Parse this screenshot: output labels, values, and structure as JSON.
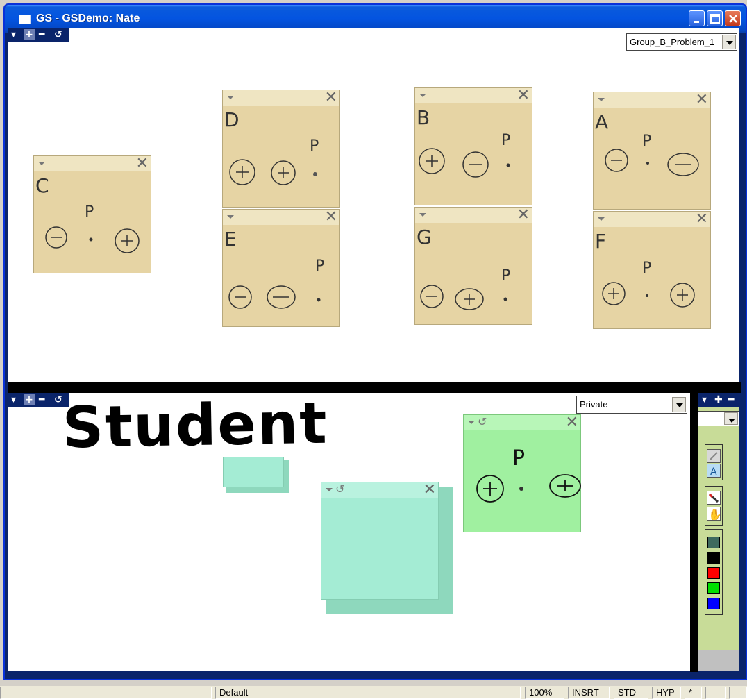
{
  "window": {
    "title": "GS - GSDemo: Nate",
    "titlebar_color": "#0454e0"
  },
  "top_pane": {
    "problem_select": "Group_B_Problem_1",
    "notes": [
      {
        "letter": "C"
      },
      {
        "letter": "D"
      },
      {
        "letter": "B"
      },
      {
        "letter": "A"
      },
      {
        "letter": "E"
      },
      {
        "letter": "G"
      },
      {
        "letter": "F"
      }
    ]
  },
  "bottom_pane": {
    "heading": "Student",
    "visibility_select": "Private"
  },
  "toolbox": {
    "icons": [
      "pen-icon",
      "text-icon",
      "eraser-icon",
      "hand-icon"
    ],
    "colors": [
      "#3f6a5e",
      "#000000",
      "#ff0000",
      "#00e000",
      "#0000ff"
    ]
  },
  "statusbar": {
    "style": "Default",
    "zoom": "100%",
    "insert_mode": "INSRT",
    "std": "STD",
    "hyp": "HYP",
    "modified": "*"
  }
}
